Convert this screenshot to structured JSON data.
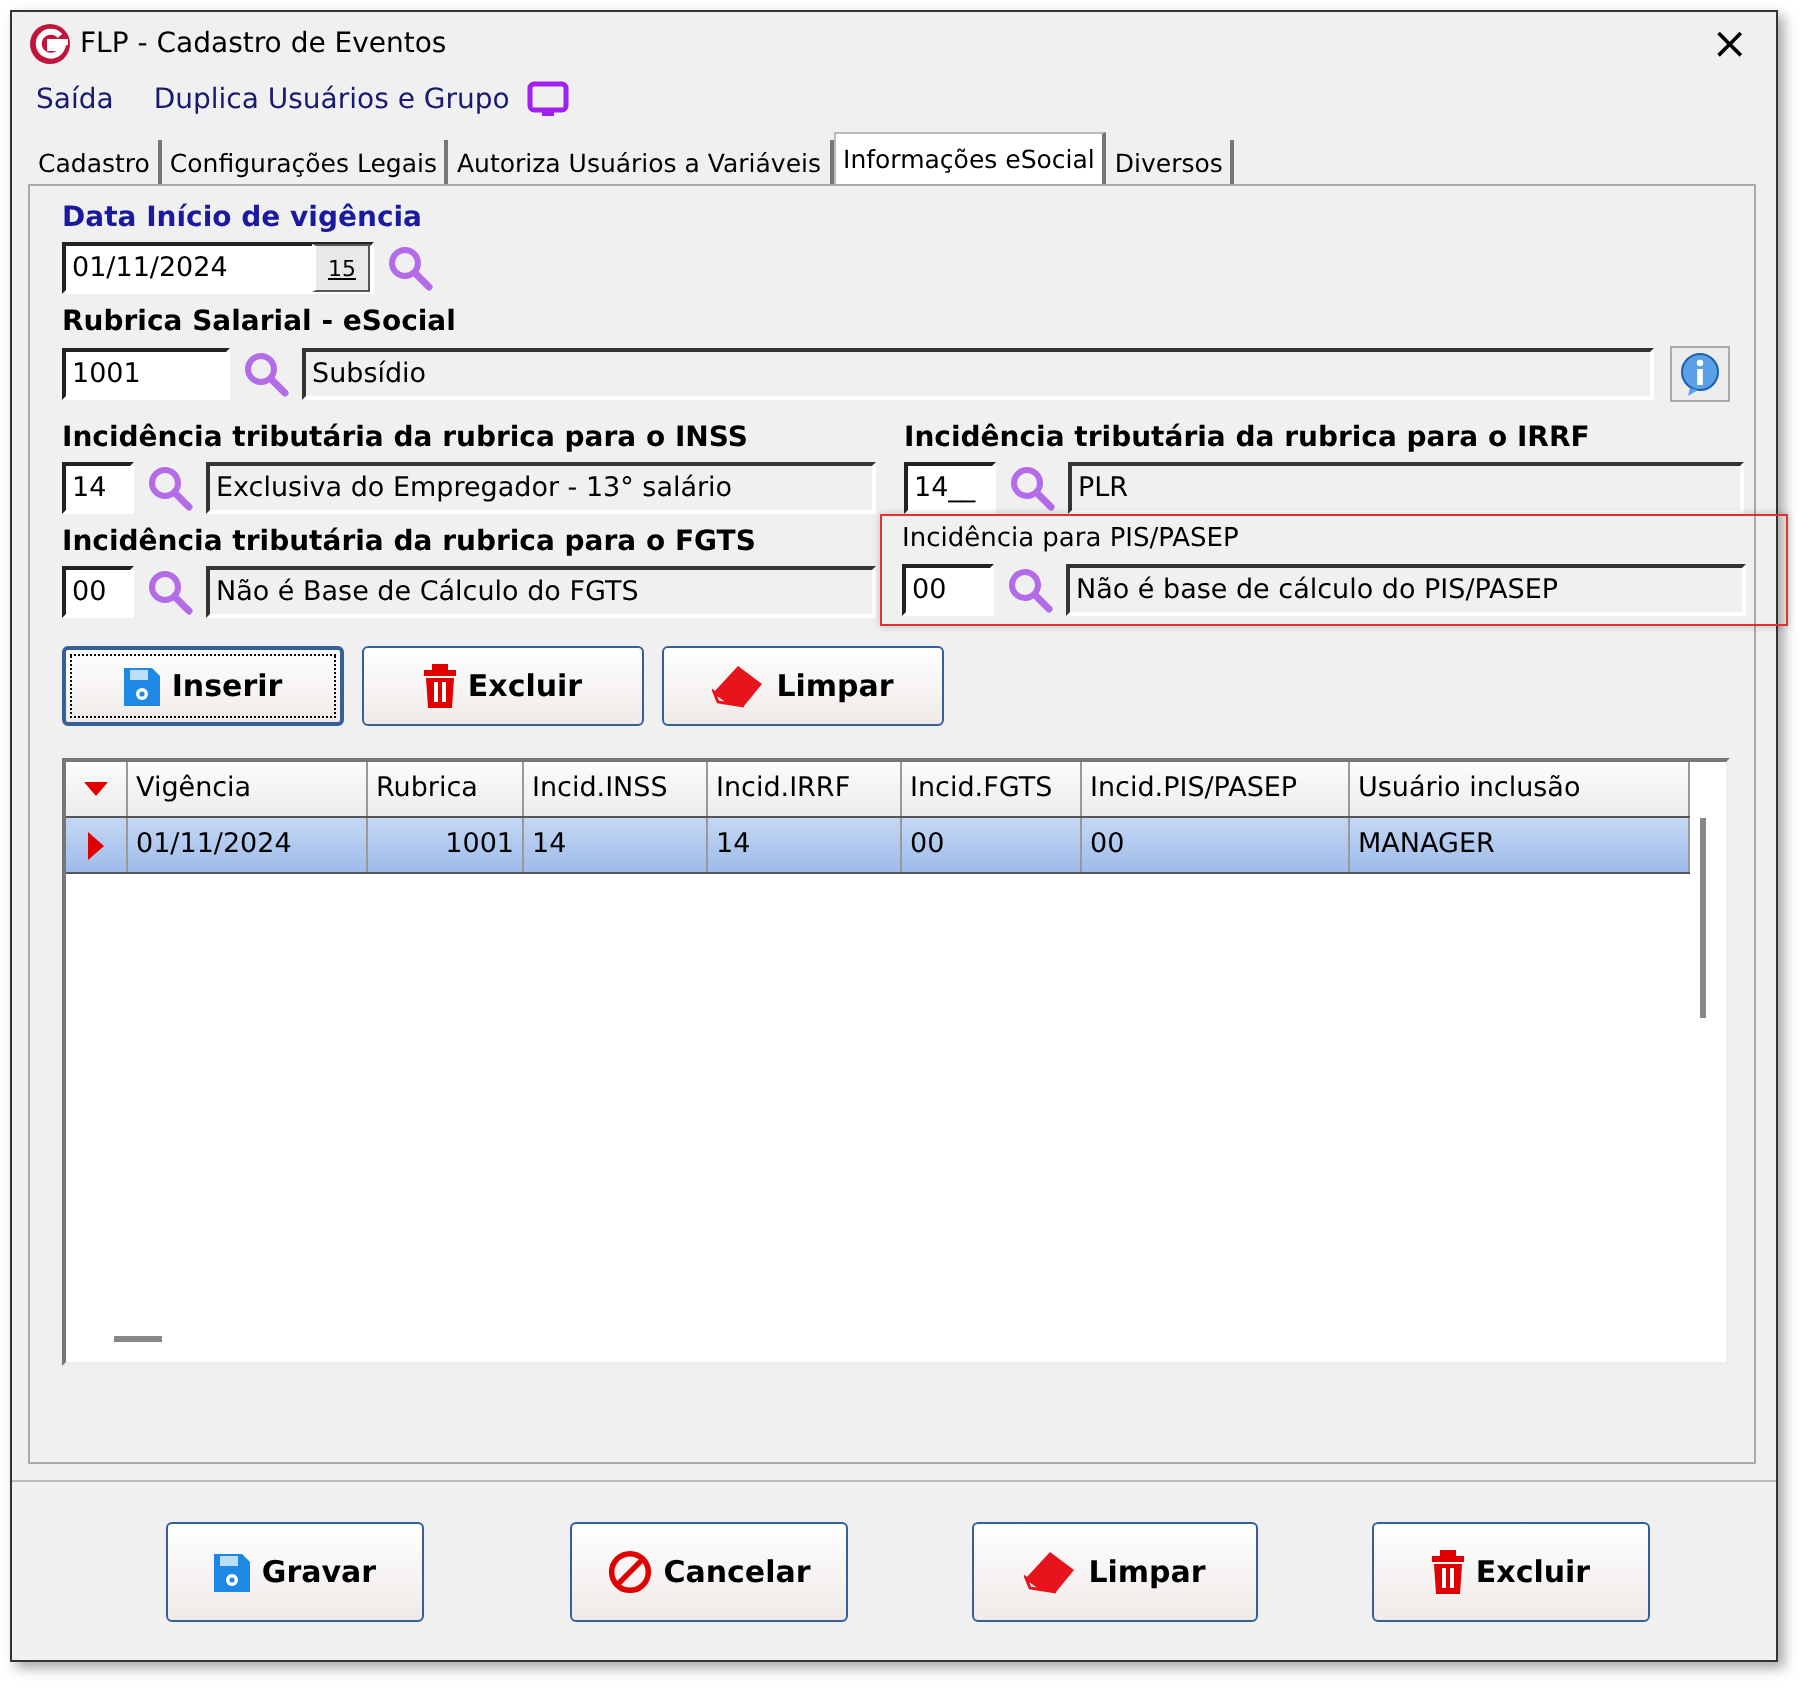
{
  "window": {
    "title": "FLP - Cadastro de Eventos",
    "close": "×"
  },
  "menu": [
    "Saída",
    "Duplica Usuários e Grupo"
  ],
  "tabs": [
    {
      "label": "Cadastro",
      "selected": false
    },
    {
      "label": "Configurações Legais",
      "selected": false
    },
    {
      "label": "Autoriza Usuários a Variáveis",
      "selected": false
    },
    {
      "label": "Informações eSocial",
      "selected": true
    },
    {
      "label": "Diversos",
      "selected": false
    }
  ],
  "start_date": {
    "label": "Data Início de vigência",
    "value": "01/11/2024",
    "calendar": "15"
  },
  "rubrica": {
    "label": "Rubrica Salarial - eSocial",
    "code": "1001",
    "description": "Subsídio"
  },
  "incidences": [
    {
      "label": "Incidência tributária da rubrica para o INSS",
      "code": "14",
      "description": "Exclusiva do Empregador - 13° salário",
      "highlighted": false
    },
    {
      "label": "Incidência tributária da rubrica para o IRRF",
      "code": "14__",
      "description": "PLR",
      "highlighted": false
    },
    {
      "label": "Incidência tributária da rubrica para o FGTS",
      "code": "00",
      "description": "Não é Base de Cálculo do FGTS",
      "highlighted": false
    },
    {
      "label": "Incidência para PIS/PASEP",
      "code": "00",
      "description": "Não é base de cálculo do PIS/PASEP",
      "highlighted": true
    }
  ],
  "actions": [
    {
      "label": "Inserir",
      "kind": "save",
      "focused": true
    },
    {
      "label": "Excluir",
      "kind": "delete",
      "focused": false
    },
    {
      "label": "Limpar",
      "kind": "clear",
      "focused": false
    }
  ],
  "table": {
    "columns": [
      "Vigência",
      "Rubrica",
      "Incid.INSS",
      "Incid.IRRF",
      "Incid.FGTS",
      "Incid.PIS/PASEP",
      "Usuário inclusão"
    ],
    "rows": [
      {
        "cells": [
          "01/11/2024",
          "1001",
          "14",
          "14",
          "00",
          "00",
          "MANAGER"
        ],
        "selected": true
      }
    ]
  },
  "footer_buttons": [
    {
      "label": "Gravar",
      "kind": "save"
    },
    {
      "label": "Cancelar",
      "kind": "cancel"
    },
    {
      "label": "Limpar",
      "kind": "clear"
    },
    {
      "label": "Excluir",
      "kind": "delete"
    }
  ]
}
